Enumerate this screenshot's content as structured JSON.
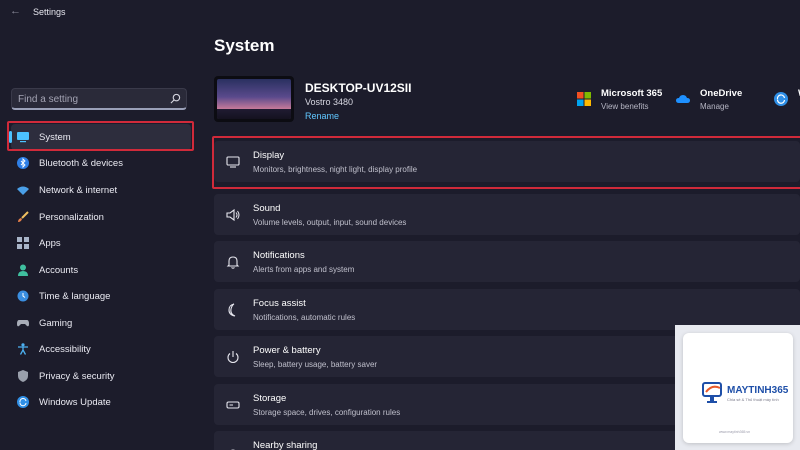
{
  "window": {
    "title": "Settings"
  },
  "search": {
    "placeholder": "Find a setting"
  },
  "sidebar": {
    "items": [
      {
        "label": "System",
        "icon": "monitor-icon",
        "active": true
      },
      {
        "label": "Bluetooth & devices",
        "icon": "bluetooth-icon"
      },
      {
        "label": "Network & internet",
        "icon": "wifi-icon"
      },
      {
        "label": "Personalization",
        "icon": "paintbrush-icon"
      },
      {
        "label": "Apps",
        "icon": "apps-grid-icon"
      },
      {
        "label": "Accounts",
        "icon": "person-icon"
      },
      {
        "label": "Time & language",
        "icon": "globe-clock-icon"
      },
      {
        "label": "Gaming",
        "icon": "gamepad-icon"
      },
      {
        "label": "Accessibility",
        "icon": "accessibility-icon"
      },
      {
        "label": "Privacy & security",
        "icon": "shield-icon"
      },
      {
        "label": "Windows Update",
        "icon": "update-icon"
      }
    ]
  },
  "page": {
    "title": "System"
  },
  "device": {
    "name": "DESKTOP-UV12SII",
    "model": "Vostro 3480",
    "rename": "Rename"
  },
  "services": [
    {
      "title": "Microsoft 365",
      "subtitle": "View benefits",
      "icon": "microsoft-logo-icon"
    },
    {
      "title": "OneDrive",
      "subtitle": "Manage",
      "icon": "onedrive-cloud-icon"
    },
    {
      "title": "W",
      "subtitle": "",
      "icon": "windows-update-sync-icon"
    }
  ],
  "cards": [
    {
      "title": "Display",
      "subtitle": "Monitors, brightness, night light, display profile",
      "icon": "display-icon"
    },
    {
      "title": "Sound",
      "subtitle": "Volume levels, output, input, sound devices",
      "icon": "speaker-icon"
    },
    {
      "title": "Notifications",
      "subtitle": "Alerts from apps and system",
      "icon": "bell-icon"
    },
    {
      "title": "Focus assist",
      "subtitle": "Notifications, automatic rules",
      "icon": "moon-icon"
    },
    {
      "title": "Power & battery",
      "subtitle": "Sleep, battery usage, battery saver",
      "icon": "power-icon"
    },
    {
      "title": "Storage",
      "subtitle": "Storage space, drives, configuration rules",
      "icon": "storage-drive-icon"
    },
    {
      "title": "Nearby sharing",
      "subtitle": "",
      "icon": "share-icon"
    }
  ],
  "watermark": {
    "brand": "MAYTINH365",
    "tagline": "Chia sẻ & Thủ thuật máy tính",
    "url": "www.maytinh365.vn"
  },
  "colors": {
    "background": "#1c1c2b",
    "card": "#252535",
    "accent": "#4cc2ff",
    "link": "#60c7ff",
    "highlight": "#d02a3a"
  }
}
